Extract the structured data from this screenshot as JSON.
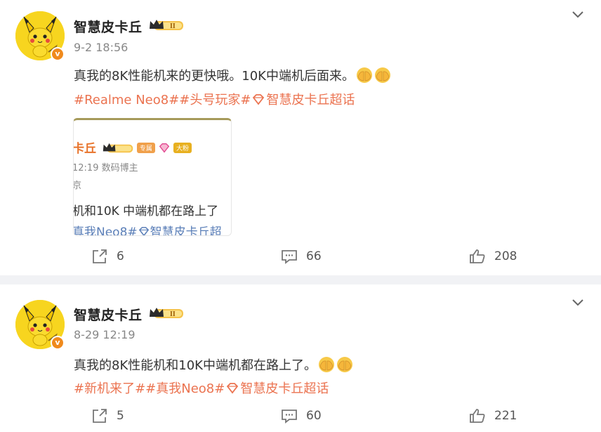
{
  "posts": [
    {
      "username": "智慧皮卡丘",
      "level_badge": "II",
      "verified_badge": "v",
      "timestamp": "9-2 18:56",
      "text": "真我的8K性能机来的更快哦。10K中端机后面来。",
      "tags": "#Realme Neo8##头号玩家#",
      "tag_super": "智慧皮卡丘超话",
      "repost": {
        "name": "卡丘",
        "pill1": "专属",
        "pill2": "大粉",
        "meta": "12:19   数码博主",
        "location": "京",
        "text": "机和10K 中端机都在路上了",
        "tags": "真我Neo8#",
        "tag_super": "智慧皮卡丘超"
      },
      "actions": {
        "repost": "6",
        "comment": "66",
        "like": "208"
      }
    },
    {
      "username": "智慧皮卡丘",
      "level_badge": "II",
      "verified_badge": "v",
      "timestamp": "8-29 12:19",
      "text": "真我的8K性能机和10K中端机都在路上了。",
      "tags": "#新机来了##真我Neo8#",
      "tag_super": "智慧皮卡丘超话",
      "actions": {
        "repost": "5",
        "comment": "60",
        "like": "221"
      }
    }
  ],
  "colors": {
    "tag": "#eb7350",
    "repost_tag": "#5b7fb8",
    "avatar_bg": "#f7d51f",
    "verified": "#f08a1d"
  },
  "icons": [
    "chevron-down-icon",
    "repost-icon",
    "comment-icon",
    "like-icon",
    "facepalm-emoji",
    "diamond-icon",
    "crown-badge-icon"
  ]
}
